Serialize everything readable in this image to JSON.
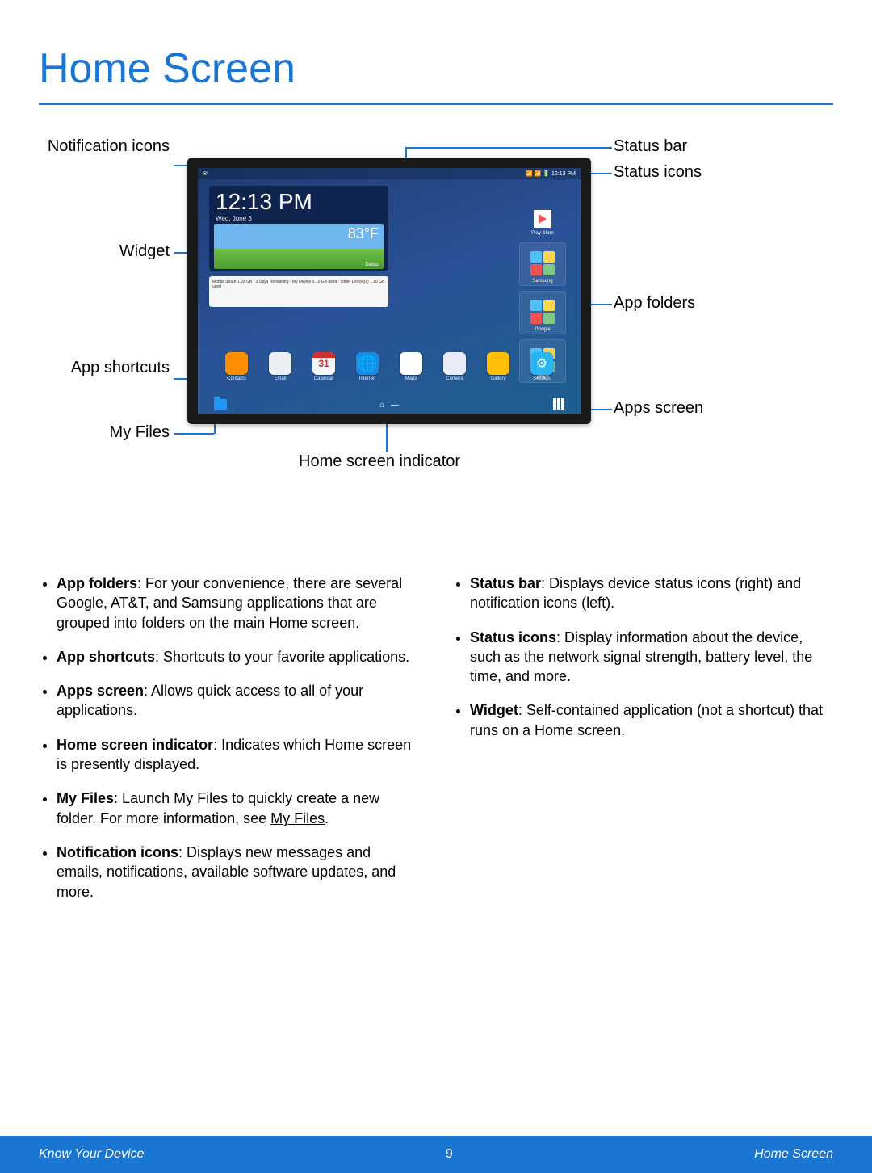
{
  "title": "Home Screen",
  "callouts": {
    "notification_icons": "Notification icons",
    "widget": "Widget",
    "app_shortcuts": "App shortcuts",
    "my_files": "My Files",
    "home_screen_indicator": "Home screen indicator",
    "status_bar": "Status bar",
    "status_icons": "Status icons",
    "app_folders": "App folders",
    "apps_screen": "Apps screen"
  },
  "tablet": {
    "status_left": "✉",
    "status_right": "📶 📶 🔋 12:13 PM",
    "clock_time": "12:13 PM",
    "clock_date": "Wed, June 3",
    "weather_temp": "83°F",
    "weather_loc": "Dallas",
    "data_widget": "Mobile Share 1.92 GB · 2 Days Remaining · My Device 0.15 GB used · Other Device(s) 1.16 GB used",
    "folders": {
      "play": "Play Store",
      "samsung": "Samsung",
      "google": "Google",
      "att": "AT&T"
    },
    "dock": {
      "contacts": "Contacts",
      "email": "Email",
      "calendar": "Calendar",
      "calendar_day": "31",
      "internet": "Internet",
      "maps": "Maps",
      "camera": "Camera",
      "gallery": "Gallery",
      "settings": "Settings"
    }
  },
  "bullets_left": [
    {
      "term": "App folders",
      "text": ": For your convenience, there are several Google, AT&T, and Samsung applications that are grouped into folders on the main Home screen."
    },
    {
      "term": "App shortcuts",
      "text": ": Shortcuts to your favorite applications."
    },
    {
      "term": "Apps screen",
      "text": ": Allows quick access to all of your applications."
    },
    {
      "term": "Home screen indicator",
      "text": ": Indicates which Home screen is presently displayed."
    },
    {
      "term": "My Files",
      "text": ": Launch My Files to quickly create a new folder. For more information, see ",
      "link": "My Files",
      "text2": "."
    },
    {
      "term": "Notification icons",
      "text": ": Displays new messages and emails, notifications, available software updates, and more."
    }
  ],
  "bullets_right": [
    {
      "term": "Status bar",
      "text": ": Displays device status icons (right) and notification icons (left)."
    },
    {
      "term": "Status icons",
      "text": ": Display information about the device, such as the network signal strength, battery level, the time, and more."
    },
    {
      "term": "Widget",
      "text": ": Self-contained application (not a shortcut) that runs on a Home screen."
    }
  ],
  "footer": {
    "left": "Know Your Device",
    "page": "9",
    "right": "Home Screen"
  }
}
